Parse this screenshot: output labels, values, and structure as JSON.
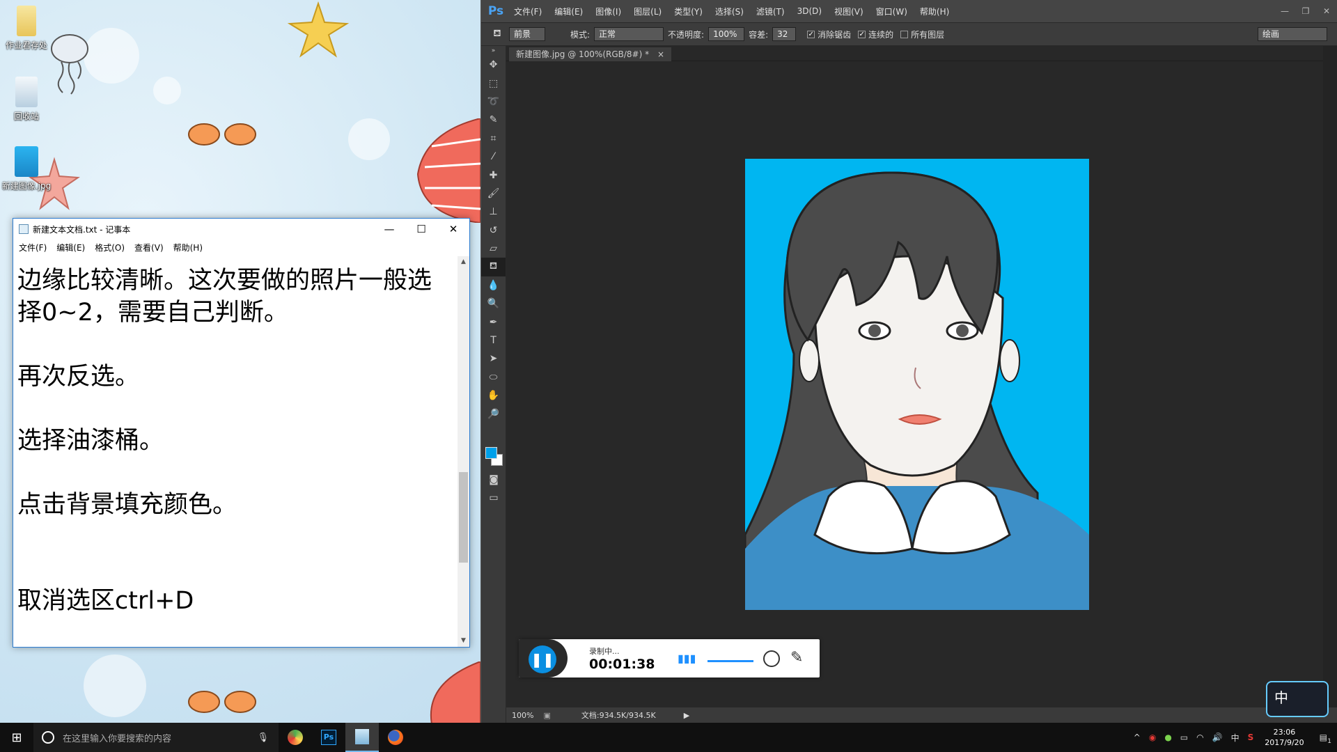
{
  "desktop": {
    "icons": [
      {
        "label": "作业君存处"
      },
      {
        "label": "回收站"
      },
      {
        "label": "新建图像.jpg"
      }
    ]
  },
  "notepad": {
    "title": "新建文本文档.txt - 记事本",
    "menu": [
      "文件(F)",
      "编辑(E)",
      "格式(O)",
      "查看(V)",
      "帮助(H)"
    ],
    "window_controls": {
      "minimize": "—",
      "maximize": "☐",
      "close": "✕"
    },
    "content": "边缘比较清晰。这次要做的照片一般选\n择0~2，需要自己判断。\n\n再次反选。\n\n选择油漆桶。\n\n点击背景填充颜色。\n\n\n取消选区ctrl+D"
  },
  "photoshop": {
    "logo": "Ps",
    "menu": [
      "文件(F)",
      "编辑(E)",
      "图像(I)",
      "图层(L)",
      "类型(Y)",
      "选择(S)",
      "滤镜(T)",
      "3D(D)",
      "视图(V)",
      "窗口(W)",
      "帮助(H)"
    ],
    "options": {
      "fill_source": "前景",
      "mode_label": "模式:",
      "mode_value": "正常",
      "opacity_label": "不透明度:",
      "opacity_value": "100%",
      "tolerance_label": "容差:",
      "tolerance_value": "32",
      "anti_alias_label": "消除锯齿",
      "anti_alias_checked": true,
      "contiguous_label": "连续的",
      "contiguous_checked": true,
      "all_layers_label": "所有图层",
      "all_layers_checked": false,
      "workspace": "绘画"
    },
    "document_tab": "新建图像.jpg @ 100%(RGB/8#) *",
    "tab_close": "×",
    "foreground_color": "#00a0e9",
    "background_color": "#ffffff",
    "canvas_bg_color": "#00b6f1",
    "status": {
      "zoom": "100%",
      "doc_info": "文档:934.5K/934.5K"
    }
  },
  "recorder": {
    "status": "录制中...",
    "time": "00:01:38"
  },
  "taskbar": {
    "search_placeholder": "在这里输入你要搜索的内容",
    "apps": [
      "ps-icon",
      "notepad-icon",
      "firefox-icon"
    ],
    "ps_label": "Ps",
    "ime": "中",
    "clock_time": "23:06",
    "clock_date": "2017/9/20",
    "notification_count": "1"
  },
  "ime_widget": {
    "label": "中"
  }
}
